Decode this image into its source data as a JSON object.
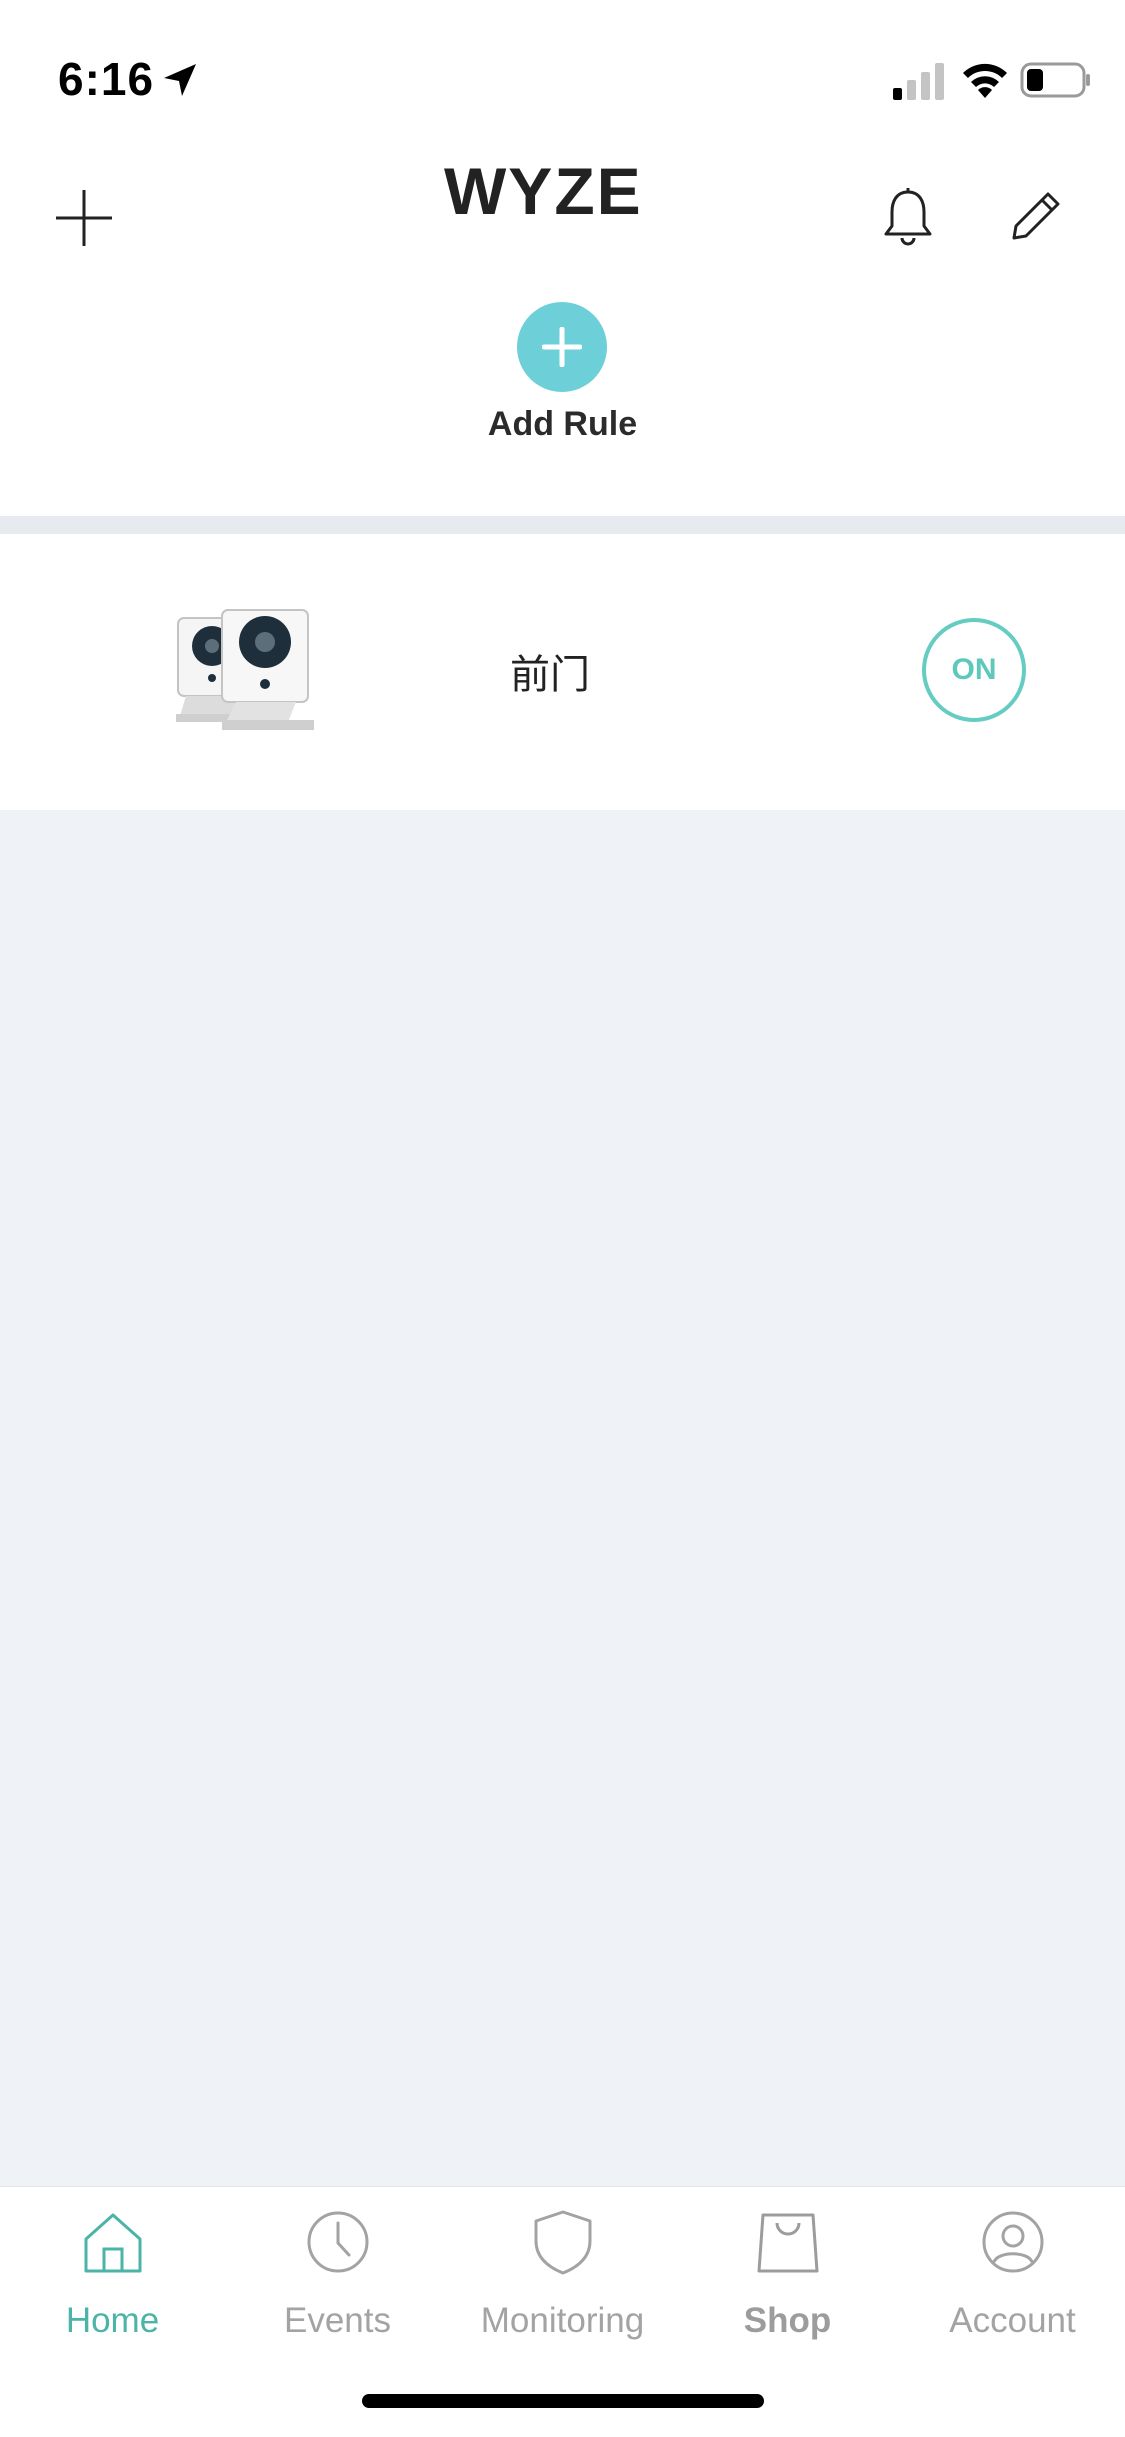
{
  "status_bar": {
    "time": "6:16",
    "icons": [
      "location-arrow-icon",
      "cellular-signal-icon",
      "wifi-icon",
      "battery-icon"
    ]
  },
  "header": {
    "logo_text": "WYZE",
    "add_device_icon": "plus-icon",
    "notification_icon": "bell-icon",
    "edit_icon": "pencil-icon"
  },
  "add_rule": {
    "label": "Add Rule",
    "icon": "plus-circle-icon",
    "color": "#6dd0d9"
  },
  "rules": [
    {
      "name": "前门",
      "device_icon": "wyze-cam-pair-icon",
      "toggle_label": "ON",
      "toggle_color": "#5ec8bc"
    }
  ],
  "tab_bar": {
    "tabs": [
      {
        "label": "Home",
        "icon": "home-icon",
        "active": true
      },
      {
        "label": "Events",
        "icon": "clock-icon",
        "active": false
      },
      {
        "label": "Monitoring",
        "icon": "shield-icon",
        "active": false
      },
      {
        "label": "Shop",
        "icon": "shopping-bag-icon",
        "active": false
      },
      {
        "label": "Account",
        "icon": "user-circle-icon",
        "active": false
      }
    ],
    "active_color": "#4bb3a7"
  }
}
